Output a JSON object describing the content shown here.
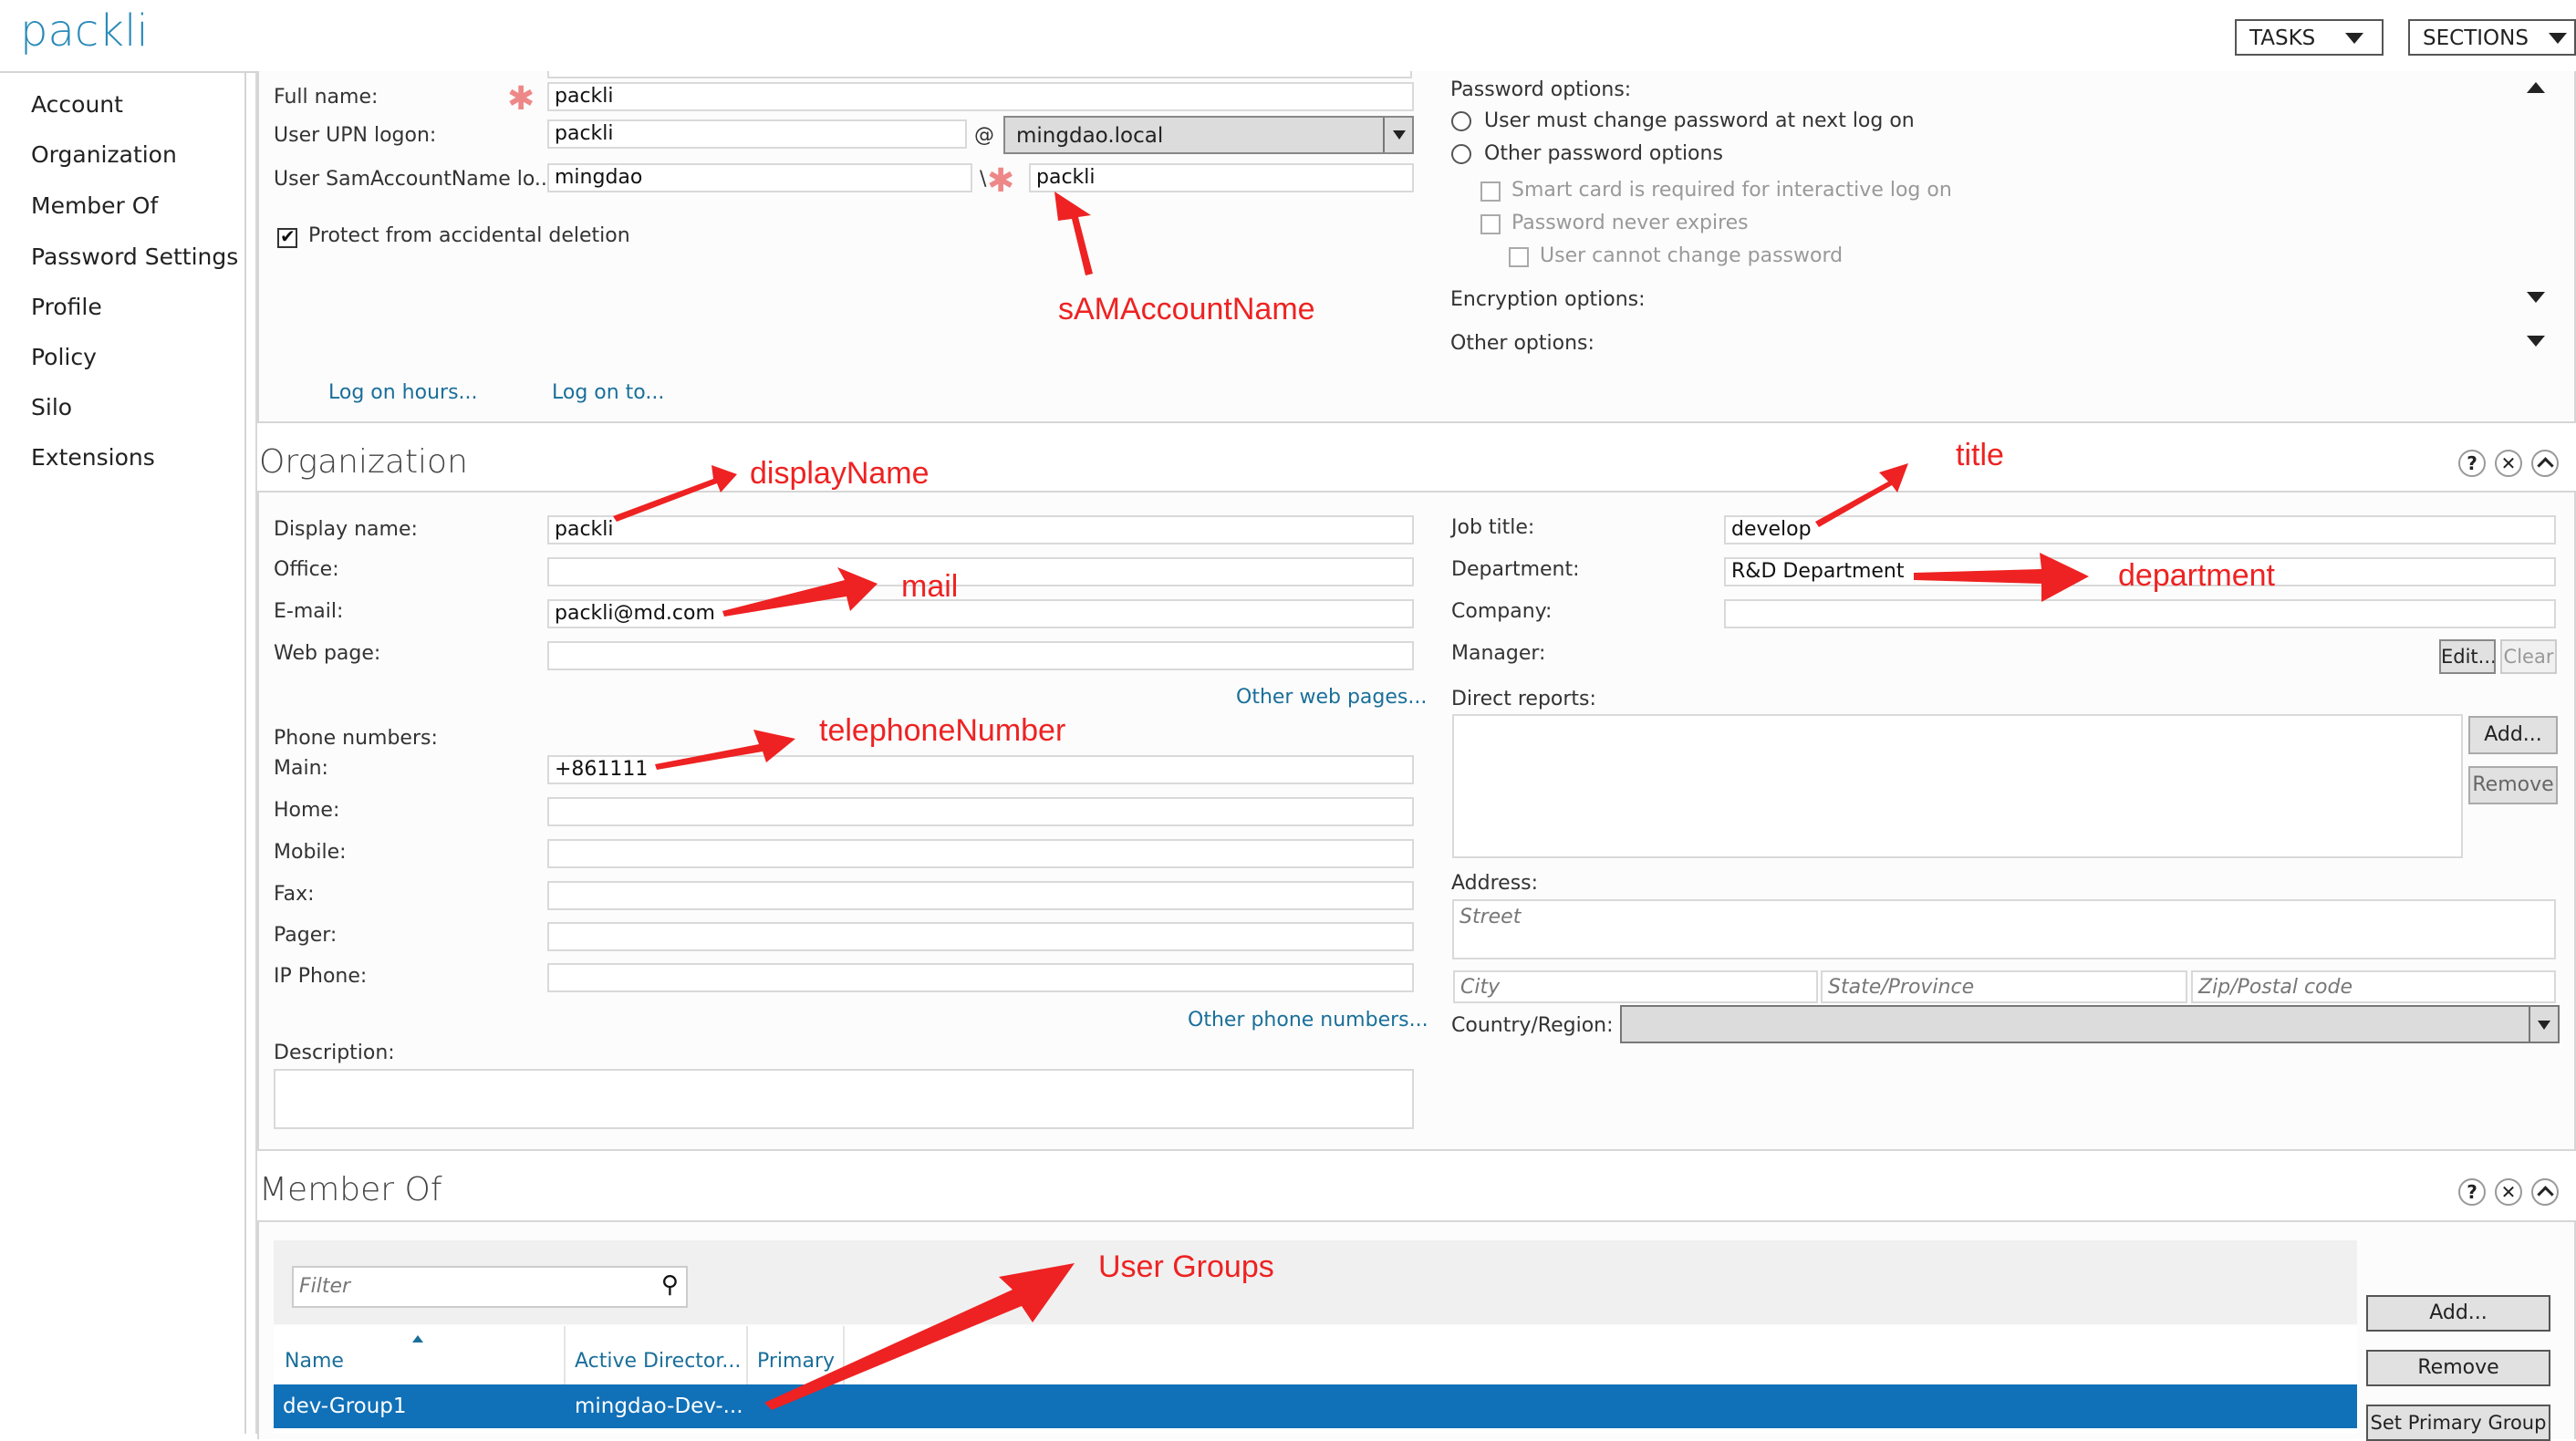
{
  "header": {
    "title": "packli",
    "tasks_label": "TASKS",
    "sections_label": "SECTIONS"
  },
  "sidebar": {
    "items": [
      {
        "label": "Account"
      },
      {
        "label": "Organization"
      },
      {
        "label": "Member Of"
      },
      {
        "label": "Password Settings"
      },
      {
        "label": "Profile"
      },
      {
        "label": "Policy"
      },
      {
        "label": "Silo"
      },
      {
        "label": "Extensions"
      }
    ]
  },
  "account": {
    "full_name_label": "Full name:",
    "full_name_value": "packli",
    "upn_label": "User UPN logon:",
    "upn_value": "packli",
    "at_sign": "@",
    "upn_domain": "mingdao.local",
    "sam_label": "User SamAccountName lo...",
    "sam_domain": "mingdao",
    "sam_separator": "\\",
    "sam_value": "packli",
    "protect_label": "Protect from accidental deletion",
    "protect_checked": true,
    "logon_hours_link": "Log on hours...",
    "logon_to_link": "Log on to...",
    "password_options_label": "Password options:",
    "radio_must_change": "User must change password at next log on",
    "radio_other": "Other password options",
    "cb_smart_card": "Smart card is required for interactive log on",
    "cb_never_expires": "Password never expires",
    "cb_cannot_change": "User cannot change password",
    "encryption_label": "Encryption options:",
    "other_options_label": "Other options:"
  },
  "organization": {
    "title": "Organization",
    "display_name_label": "Display name:",
    "display_name_value": "packli",
    "office_label": "Office:",
    "office_value": "",
    "email_label": "E-mail:",
    "email_value": "packli@md.com",
    "web_label": "Web page:",
    "web_value": "",
    "other_web_link": "Other web pages...",
    "phone_header": "Phone numbers:",
    "main_label": "Main:",
    "main_value": "+861111",
    "home_label": "Home:",
    "mobile_label": "Mobile:",
    "fax_label": "Fax:",
    "pager_label": "Pager:",
    "ip_phone_label": "IP Phone:",
    "other_phone_link": "Other phone numbers...",
    "description_label": "Description:",
    "job_title_label": "Job title:",
    "job_title_value": "develop",
    "department_label": "Department:",
    "department_value": "R&D Department",
    "company_label": "Company:",
    "company_value": "",
    "manager_label": "Manager:",
    "edit_button": "Edit...",
    "clear_button": "Clear",
    "direct_reports_label": "Direct reports:",
    "add_button": "Add...",
    "remove_button": "Remove",
    "address_label": "Address:",
    "street_placeholder": "Street",
    "city_placeholder": "City",
    "state_placeholder": "State/Province",
    "zip_placeholder": "Zip/Postal code",
    "country_label": "Country/Region:",
    "country_value": ""
  },
  "member_of": {
    "title": "Member Of",
    "filter_placeholder": "Filter",
    "columns": [
      "Name",
      "Active Director...",
      "Primary"
    ],
    "rows": [
      {
        "name": "dev-Group1",
        "ad_path": "mingdao-Dev-...",
        "primary": ""
      }
    ],
    "add_button": "Add...",
    "remove_button": "Remove",
    "set_primary_button": "Set Primary Group"
  },
  "section_icons": {
    "help": "?",
    "close": "✕",
    "collapse": "^"
  },
  "annotations": {
    "sam": "sAMAccountName",
    "display_name": "displayName",
    "mail": "mail",
    "telephone": "telephoneNumber",
    "title": "title",
    "department": "department",
    "groups": "User Groups"
  },
  "colors": {
    "accent": "#1a6f9a",
    "selection": "#1070b8",
    "annotation": "#ee2222"
  }
}
